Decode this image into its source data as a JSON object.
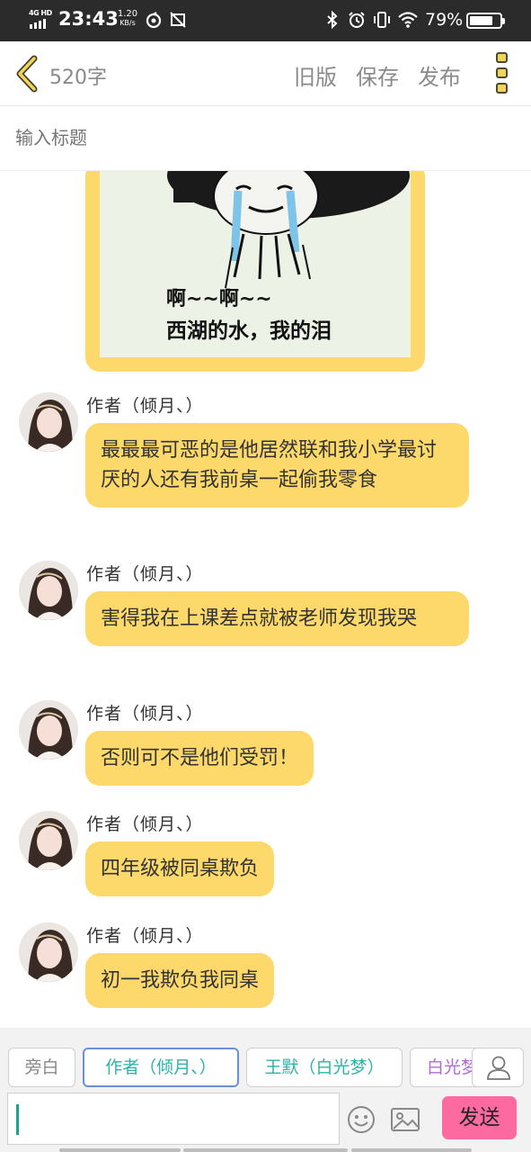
{
  "status_bar": {
    "network": "4G HD",
    "time": "23:43",
    "speed_value": "1.20",
    "speed_unit": "KB/s",
    "battery_percent": "79%",
    "battery_level": 0.79,
    "icons": [
      "netease-music-icon",
      "no-screenshot-icon",
      "bluetooth-icon",
      "alarm-icon",
      "vibrate-icon",
      "wifi-icon",
      "battery-icon"
    ]
  },
  "header": {
    "back_icon": "chevron-left-icon",
    "word_count": "520字",
    "actions": [
      "旧版",
      "保存",
      "发布"
    ],
    "more_icon": "more-vertical-icon"
  },
  "title_input": {
    "placeholder": "输入标题"
  },
  "image_message": {
    "caption_line1": "啊~~啊~~",
    "caption_line2": "西湖的水，我的泪"
  },
  "messages": [
    {
      "author": "作者（倾月、）",
      "text": "最最最可恶的是他居然联和我小学最讨厌的人还有我前桌一起偷我零食"
    },
    {
      "author": "作者（倾月、）",
      "text": "害得我在上课差点就被老师发现我哭"
    },
    {
      "author": "作者（倾月、）",
      "text": "否则可不是他们受罚！"
    },
    {
      "author": "作者（倾月、）",
      "text": "四年级被同桌欺负"
    },
    {
      "author": "作者（倾月、）",
      "text": "初一我欺负我同桌"
    }
  ],
  "roles": [
    {
      "label": "旁白",
      "color": "#888888"
    },
    {
      "label": "作者（倾月、）",
      "color": "#2bb3a7",
      "selected": true
    },
    {
      "label": "王默（白光梦）",
      "color": "#2bb3a7"
    },
    {
      "label": "白光梦",
      "color": "#b06ad6"
    }
  ],
  "composer": {
    "emoji_icon": "emoji-icon",
    "image_icon": "image-icon",
    "send_label": "发送",
    "person_icon": "person-icon"
  },
  "colors": {
    "bubble": "#fcd96a",
    "accent_teal": "#2bb3a7",
    "send": "#fd6aa0",
    "status_bar": "#2b2b2b"
  }
}
